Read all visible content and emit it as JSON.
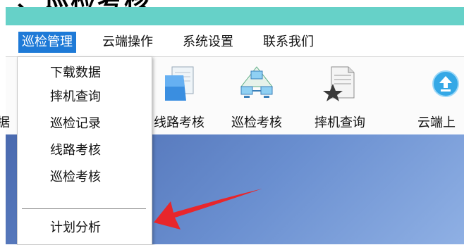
{
  "title": {
    "text": "、巡检考核"
  },
  "menubar": {
    "items": [
      {
        "label": "巡检管理",
        "active": true
      },
      {
        "label": "云端操作"
      },
      {
        "label": "系统设置"
      },
      {
        "label": "联系我们"
      }
    ]
  },
  "toolbar": {
    "items": [
      {
        "label": "据",
        "icon": "partial-icon"
      },
      {
        "label": "线路考核",
        "icon": "document-pages-icon"
      },
      {
        "label": "巡检考核",
        "icon": "network-computers-icon"
      },
      {
        "label": "摔机查询",
        "icon": "document-star-icon"
      },
      {
        "label": "云端上",
        "icon": "cloud-upload-icon"
      }
    ]
  },
  "dropdown": {
    "items": [
      {
        "label": "下载数据"
      },
      {
        "label": "摔机查询"
      },
      {
        "label": "巡检记录"
      },
      {
        "label": "线路考核"
      },
      {
        "label": "巡检考核"
      },
      {
        "label": "计划分析"
      }
    ]
  },
  "colors": {
    "teal_bar": "#66d1c8",
    "menu_active_bg": "#1e7ad7",
    "arrow": "#e8262b",
    "main_bg": "#5a7cc0"
  }
}
